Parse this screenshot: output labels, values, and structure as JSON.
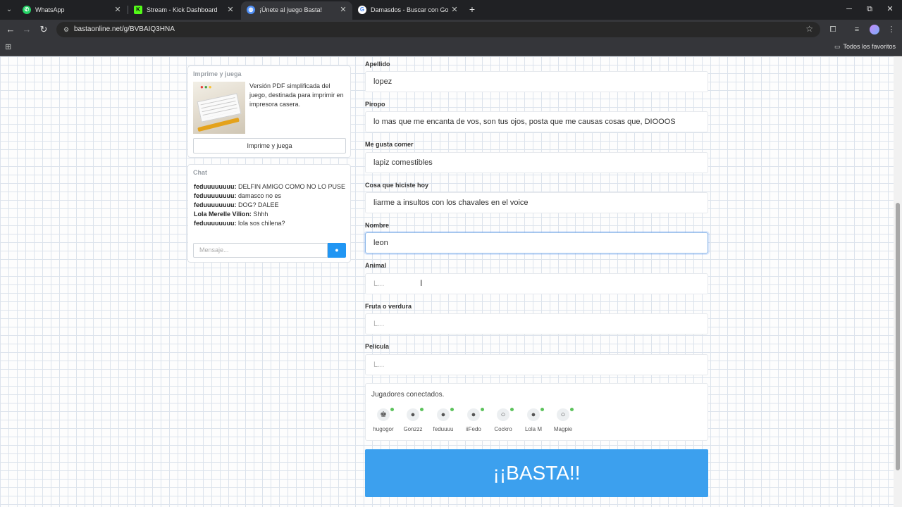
{
  "browser": {
    "tabs": [
      {
        "title": "WhatsApp",
        "favicon_color": "#25d366"
      },
      {
        "title": "Stream - Kick Dashboard",
        "favicon_color": "#53fc18"
      },
      {
        "title": "¡Únete al juego Basta!",
        "favicon_color": "#4f8ff7",
        "active": true
      },
      {
        "title": "Damasdos - Buscar con Google",
        "favicon_color": "#ffffff"
      }
    ],
    "url": "bastaonline.net/g/BVBAIQ3HNA",
    "bookmarks_all": "Todos los favoritos"
  },
  "sidebar": {
    "print": {
      "title": "Imprime y juega",
      "description": "Versión PDF simplificada del juego, destinada para imprimir en impresora casera.",
      "button": "Imprime y juega"
    },
    "chat": {
      "title": "Chat",
      "messages": [
        {
          "user": "feduuuuuuuu:",
          "text": " DELFIN AMIGO COMO NO LO PUSE"
        },
        {
          "user": "feduuuuuuuu:",
          "text": " damasco no es"
        },
        {
          "user": "feduuuuuuuu:",
          "text": " DOG? DALEE"
        },
        {
          "user": "Lola Merelle Vilion:",
          "text": " Shhh"
        },
        {
          "user": "feduuuuuuuu:",
          "text": " lola sos chilena?"
        }
      ],
      "input_placeholder": "Mensaje..."
    }
  },
  "form": {
    "fields": [
      {
        "label": "Apellido",
        "value": "lopez"
      },
      {
        "label": "Piropo",
        "value": "lo mas que me encanta de vos, son tus ojos, posta que me causas cosas que, DIOOOS"
      },
      {
        "label": "Me gusta comer",
        "value": "lapiz comestibles"
      },
      {
        "label": "Cosa que hiciste hoy",
        "value": "liarme a insultos con los chavales en el voice"
      },
      {
        "label": "Nombre",
        "value": "leon"
      },
      {
        "label": "Animal",
        "placeholder": "L..."
      },
      {
        "label": "Fruta o verdura",
        "placeholder": "L..."
      },
      {
        "label": "Película",
        "placeholder": "L..."
      }
    ],
    "players_title": "Jugadores conectados.",
    "players": [
      "hugogor",
      "Gonzzz",
      "feduuuu",
      "iiFedo",
      "Cockro",
      "Lola M",
      "Magpie"
    ],
    "basta_label": "¡¡BASTA!!"
  },
  "colors": {
    "accent": "#3ca0ee",
    "online": "#5cc25c"
  }
}
